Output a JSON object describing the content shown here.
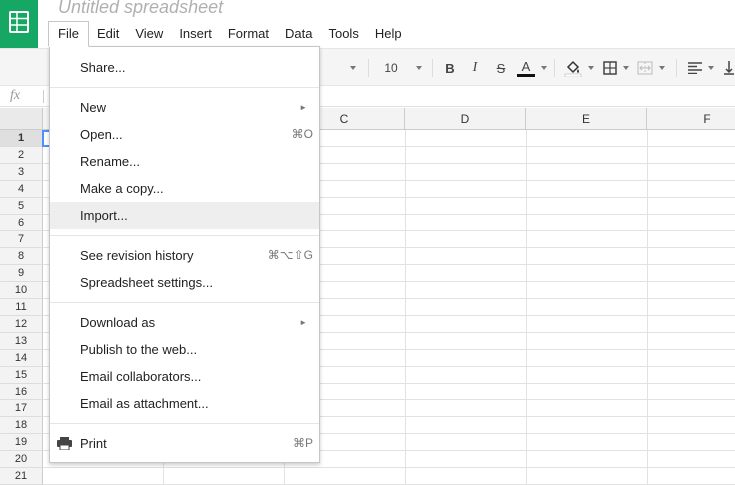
{
  "app": {
    "title": "Untitled spreadsheet",
    "brand_color": "#16a765",
    "logo_icon": "sheets-logo-icon"
  },
  "menubar": {
    "items": [
      "File",
      "Edit",
      "View",
      "Insert",
      "Format",
      "Data",
      "Tools",
      "Help"
    ],
    "active": "File"
  },
  "toolbar": {
    "font_size": "10",
    "bold": "B",
    "italic": "I",
    "strike": "S",
    "text_color": "A",
    "icons": [
      "font-family-dropdown",
      "font-size-dropdown",
      "bold-icon",
      "italic-icon",
      "strikethrough-icon",
      "text-color-icon",
      "fill-color-icon",
      "borders-icon",
      "merge-cells-icon",
      "align-left-icon",
      "vertical-align-icon"
    ]
  },
  "formula_bar": {
    "fx_label": "fx",
    "value": ""
  },
  "grid": {
    "columns": [
      "C",
      "D",
      "E",
      "F"
    ],
    "rows": [
      "1",
      "2",
      "3",
      "4",
      "5",
      "6",
      "7",
      "8",
      "9",
      "10",
      "11",
      "12",
      "13",
      "14",
      "15",
      "16",
      "17",
      "18",
      "19",
      "20",
      "21"
    ],
    "selected_row": "1"
  },
  "file_menu": {
    "items": {
      "share": {
        "label": "Share..."
      },
      "new": {
        "label": "New",
        "submenu": "►"
      },
      "open": {
        "label": "Open...",
        "shortcut": "⌘O"
      },
      "rename": {
        "label": "Rename..."
      },
      "make_copy": {
        "label": "Make a copy..."
      },
      "import": {
        "label": "Import..."
      },
      "revision_history": {
        "label": "See revision history",
        "shortcut": "⌘⌥⇧G"
      },
      "settings": {
        "label": "Spreadsheet settings..."
      },
      "download_as": {
        "label": "Download as",
        "submenu": "►"
      },
      "publish": {
        "label": "Publish to the web..."
      },
      "email_collaborators": {
        "label": "Email collaborators..."
      },
      "email_attachment": {
        "label": "Email as attachment..."
      },
      "print": {
        "label": "Print",
        "shortcut": "⌘P",
        "icon": "printer-icon"
      }
    },
    "hovered": "import"
  }
}
